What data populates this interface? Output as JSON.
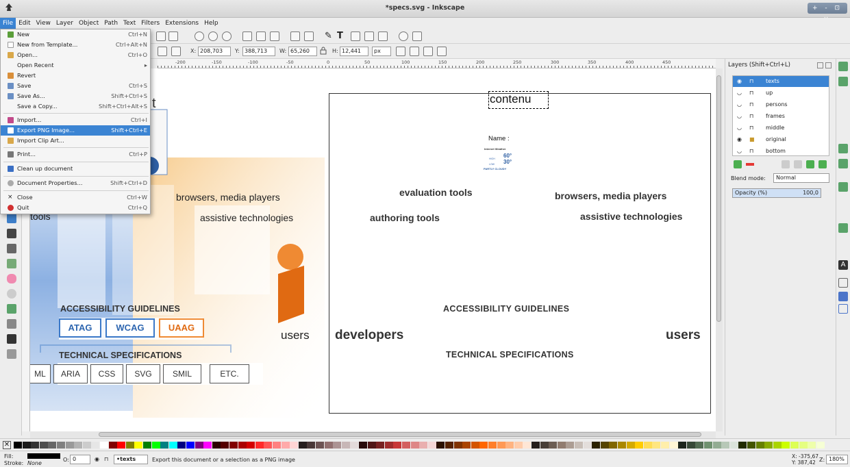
{
  "window": {
    "title": "*specs.svg - Inkscape",
    "controls": "+ - ⊡ ×"
  },
  "menubar": [
    "File",
    "Edit",
    "View",
    "Layer",
    "Object",
    "Path",
    "Text",
    "Filters",
    "Extensions",
    "Help"
  ],
  "file_menu": [
    {
      "label": "New",
      "shortcut": "Ctrl+N",
      "icon": "new-doc-icon",
      "color": "#5b9e3a"
    },
    {
      "label": "New from Template...",
      "shortcut": "Ctrl+Alt+N",
      "icon": "template-icon",
      "color": "#bbbbbb"
    },
    {
      "label": "Open...",
      "shortcut": "Ctrl+O",
      "icon": "folder-open-icon",
      "color": "#d9a84a"
    },
    {
      "label": "Open Recent",
      "shortcut": "▸",
      "icon": "",
      "color": ""
    },
    {
      "label": "Revert",
      "shortcut": "",
      "icon": "revert-icon",
      "color": "#d98f3a"
    },
    {
      "label": "Save",
      "shortcut": "Ctrl+S",
      "icon": "save-icon",
      "color": "#6a8fc4"
    },
    {
      "label": "Save As...",
      "shortcut": "Shift+Ctrl+S",
      "icon": "save-as-icon",
      "color": "#6a8fc4"
    },
    {
      "label": "Save a Copy...",
      "shortcut": "Shift+Ctrl+Alt+S",
      "icon": "",
      "color": ""
    },
    {
      "label": "Import...",
      "shortcut": "Ctrl+I",
      "icon": "import-icon",
      "color": "#c24a8a"
    },
    {
      "label": "Export PNG Image...",
      "shortcut": "Shift+Ctrl+E",
      "icon": "export-png-icon",
      "color": "#ffffff",
      "highlighted": true
    },
    {
      "label": "Import Clip Art...",
      "shortcut": "",
      "icon": "clip-art-icon",
      "color": "#d9a84a"
    },
    {
      "label": "Print...",
      "shortcut": "Ctrl+P",
      "icon": "print-icon",
      "color": "#777777"
    },
    {
      "label": "Clean up document",
      "shortcut": "",
      "icon": "clean-up-icon",
      "color": "#3a6fc4"
    },
    {
      "label": "Document Properties...",
      "shortcut": "Shift+Ctrl+D",
      "icon": "document-properties-icon",
      "color": "#aaaaaa"
    },
    {
      "label": "Close",
      "shortcut": "Ctrl+W",
      "icon": "close-icon",
      "color": ""
    },
    {
      "label": "Quit",
      "shortcut": "Ctrl+Q",
      "icon": "quit-icon",
      "color": "#d13030"
    }
  ],
  "controls": {
    "x_label": "X:",
    "x_value": "208,703",
    "y_label": "Y:",
    "y_value": "388,713",
    "w_label": "W:",
    "w_value": "65,260",
    "h_label": "H:",
    "h_value": "12,441",
    "unit": "px"
  },
  "ruler_ticks": [
    "-200",
    "-150",
    "-100",
    "-50",
    "0",
    "50",
    "100",
    "150",
    "200",
    "250",
    "300",
    "350",
    "400",
    "450"
  ],
  "artwork": {
    "partial_heading": "t",
    "tools": "tools",
    "browsers": "browsers, media players",
    "assistive": "assistive technologies",
    "users": "users",
    "guidelines": "ACCESSIBILITY GUIDELINES",
    "atag": "ATAG",
    "wcag": "WCAG",
    "uaag": "UAAG",
    "techspecs": "TECHNICAL SPECIFICATIONS",
    "specs": [
      "ML",
      "ARIA",
      "CSS",
      "SVG",
      "SMIL",
      "ETC."
    ]
  },
  "page": {
    "contenu": "contenu",
    "name": "Name :",
    "weather_title": "Internet Weather",
    "temp_high": "60°",
    "temp_low": "30°",
    "high_label": "HIGH",
    "low_label": "LOW",
    "weather_status": "PARTLY CLOUDY",
    "evaluation": "evaluation tools",
    "authoring": "authoring tools",
    "browsers": "browsers, media players",
    "assistive": "assistive technologies",
    "guidelines": "ACCESSIBILITY GUIDELINES",
    "developers": "developers",
    "users": "users",
    "techspecs": "TECHNICAL SPECIFICATIONS"
  },
  "layers_panel": {
    "title": "Layers (Shift+Ctrl+L)",
    "layers": [
      "texts",
      "up",
      "persons",
      "frames",
      "middle",
      "original",
      "bottom"
    ],
    "selected": "texts",
    "blend_label": "Blend mode:",
    "blend_value": "Normal",
    "opacity_label": "Opacity (%)",
    "opacity_value": "100,0"
  },
  "palette": [
    "#000000",
    "#1a1a1a",
    "#333333",
    "#4d4d4d",
    "#666666",
    "#808080",
    "#999999",
    "#b3b3b3",
    "#cccccc",
    "#e6e6e6",
    "#ffffff",
    "#800000",
    "#ff0000",
    "#808000",
    "#ffff00",
    "#008000",
    "#00ff00",
    "#008080",
    "#00ffff",
    "#000080",
    "#0000ff",
    "#800080",
    "#ff00ff",
    "#2b0000",
    "#550000",
    "#800000",
    "#aa0000",
    "#d40000",
    "#ff2a2a",
    "#ff5555",
    "#ff8080",
    "#ffaaaa",
    "#ffd5d5",
    "#241c1c",
    "#483737",
    "#6c5353",
    "#916f6f",
    "#ac9393",
    "#c8b7b7",
    "#e3dbdb",
    "#280b0b",
    "#501616",
    "#782121",
    "#a02c2c",
    "#c83737",
    "#d35f5f",
    "#de8787",
    "#e9afaf",
    "#f4d7d7",
    "#2b1100",
    "#552200",
    "#803300",
    "#aa4400",
    "#d45500",
    "#ff6600",
    "#ff7f2a",
    "#ff9955",
    "#ffb380",
    "#ffccaa",
    "#ffe6d5",
    "#241f1c",
    "#483e37",
    "#6c5d53",
    "#917c6f",
    "#ac9d93",
    "#c8beb7",
    "#e3dedb",
    "#2b2200",
    "#554400",
    "#806600",
    "#aa8800",
    "#d4aa00",
    "#ffcc00",
    "#ffdd55",
    "#ffe680",
    "#ffeeaa",
    "#fff6d5",
    "#1c241c",
    "#374837",
    "#536c53",
    "#6f916f",
    "#93ac93",
    "#b7c8b7",
    "#dbe3db",
    "#222b00",
    "#445500",
    "#668000",
    "#88aa00",
    "#aad400",
    "#ccff00",
    "#ddff55",
    "#e5ff80",
    "#eeffaa",
    "#f6ffd5"
  ],
  "status": {
    "fill_label": "Fill:",
    "stroke_label": "Stroke:",
    "stroke_value": "None",
    "opacity_label": "O:",
    "opacity_value": "0",
    "layer": "•texts",
    "message": "Export this document or a selection as a PNG image",
    "coord_x": "X: -375,67",
    "coord_y": "Y:  387,42",
    "zoom_label": "Z:",
    "zoom": "180%"
  }
}
